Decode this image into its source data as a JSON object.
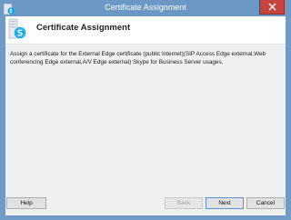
{
  "window": {
    "title": "Certificate Assignment",
    "close_icon": "close-icon",
    "app_icon": "skype-server-icon"
  },
  "header": {
    "title": "Certificate Assignment",
    "logo_icon": "skype-for-business-logo-icon"
  },
  "body": {
    "description": "Assign a certificate for the External Edge certificate (public Internet)(SIP Access Edge external,Web conferencing Edge external,A/V Edge external) Skype for Business Server usages."
  },
  "buttons": {
    "help": "Help",
    "back": "Back",
    "next": "Next",
    "cancel": "Cancel"
  },
  "colors": {
    "titlebar": "#6b98c4",
    "close": "#c6463f",
    "skype_blue": "#00a2e8",
    "client_bg": "#f0f0f0"
  }
}
